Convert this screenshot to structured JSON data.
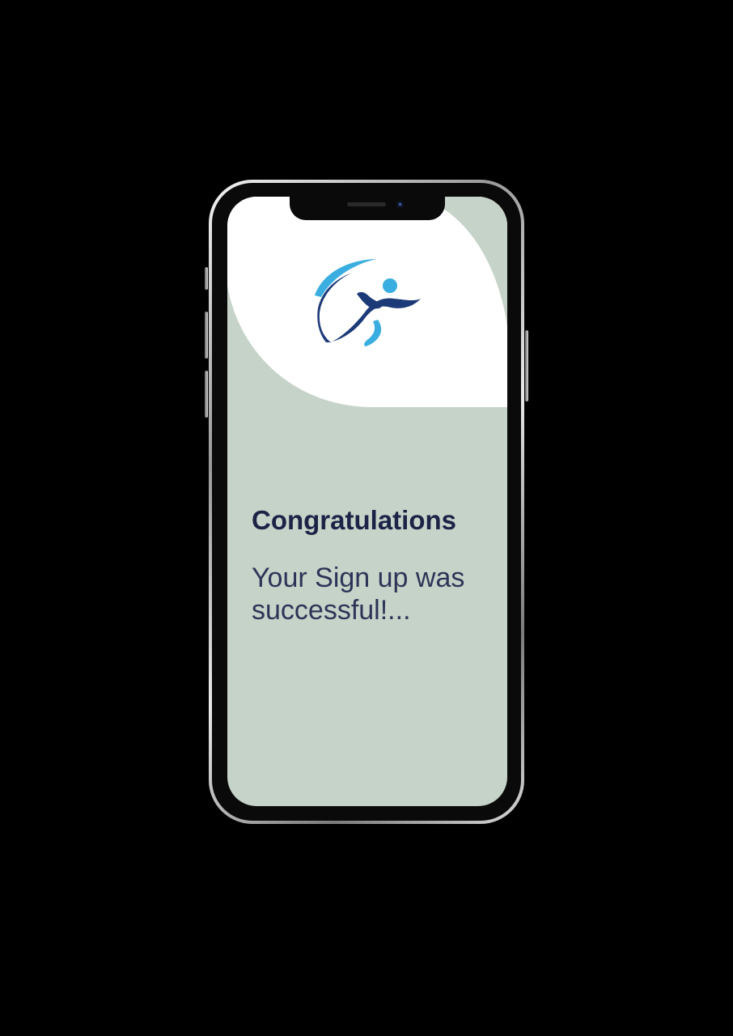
{
  "screen": {
    "title": "Congratulations",
    "message": "Your Sign up was successful!..."
  },
  "logo": {
    "icon": "runner-logo-icon",
    "colors": {
      "navy": "#1d3a78",
      "light_blue": "#3aaee0"
    }
  },
  "colors": {
    "background": "#000000",
    "screen_background": "#c6d3c8",
    "header_shape": "#ffffff",
    "title_text": "#1b2347",
    "message_text": "#2c3558"
  }
}
